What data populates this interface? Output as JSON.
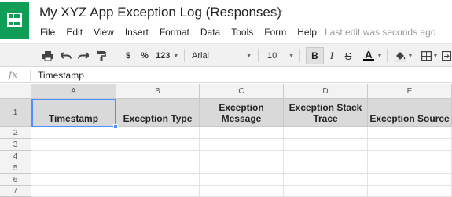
{
  "doc": {
    "title": "My XYZ App Exception Log (Responses)",
    "star": "☆",
    "last_edit": "Last edit was seconds ago"
  },
  "menu": [
    "File",
    "Edit",
    "View",
    "Insert",
    "Format",
    "Data",
    "Tools",
    "Form",
    "Help"
  ],
  "toolbar": {
    "currency": "$",
    "percent": "%",
    "number_format": "123",
    "font": "Arial",
    "font_size": "10",
    "bold": "B",
    "italic": "I",
    "strike": "S",
    "text_color": "A",
    "text_color_value": "#000000"
  },
  "formula": {
    "fx": "fx",
    "value": "Timestamp"
  },
  "grid": {
    "columns": [
      "A",
      "B",
      "C",
      "D",
      "E"
    ],
    "rows": [
      "1",
      "2",
      "3",
      "4",
      "5",
      "6",
      "7"
    ],
    "header_row": [
      "Timestamp",
      "Exception Type",
      "Exception Message",
      "Exception Stack Trace",
      "Exception Source"
    ],
    "selected_cell": "A1"
  },
  "colors": {
    "brand": "#0f9d58",
    "selection": "#4d90fe"
  }
}
